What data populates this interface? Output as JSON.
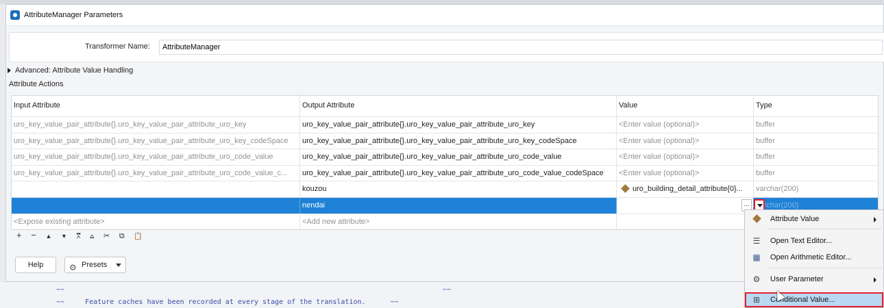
{
  "window": {
    "title": "AttributeManager Parameters"
  },
  "transformer": {
    "label": "Transformer Name:",
    "value": "AttributeManager"
  },
  "advanced": {
    "label": "Advanced: Attribute Value Handling"
  },
  "section": {
    "label": "Attribute Actions"
  },
  "table": {
    "headers": {
      "input": "Input Attribute",
      "output": "Output Attribute",
      "value": "Value",
      "type": "Type"
    },
    "rows": [
      {
        "input": "uro_key_value_pair_attribute{}.uro_key_value_pair_attribute_uro_key",
        "output": "uro_key_value_pair_attribute{}.uro_key_value_pair_attribute_uro_key",
        "value": "<Enter value (optional)>",
        "type": "buffer"
      },
      {
        "input": "uro_key_value_pair_attribute{}.uro_key_value_pair_attribute_uro_key_codeSpace",
        "output": "uro_key_value_pair_attribute{}.uro_key_value_pair_attribute_uro_key_codeSpace",
        "value": "<Enter value (optional)>",
        "type": "buffer"
      },
      {
        "input": "uro_key_value_pair_attribute{}.uro_key_value_pair_attribute_uro_code_value",
        "output": "uro_key_value_pair_attribute{}.uro_key_value_pair_attribute_uro_code_value",
        "value": "<Enter value (optional)>",
        "type": "buffer"
      },
      {
        "input": "uro_key_value_pair_attribute{}.uro_key_value_pair_attribute_uro_code_value_c...",
        "output": "uro_key_value_pair_attribute{}.uro_key_value_pair_attribute_uro_code_value_codeSpace",
        "value": "<Enter value (optional)>",
        "type": "buffer"
      },
      {
        "input": "",
        "output": "kouzou",
        "value": "uro_building_detail_attribute{0}...",
        "type": "varchar(200)"
      },
      {
        "input": "",
        "output": "nendai",
        "value": "",
        "type": "varchar(200)"
      },
      {
        "input": "<Expose existing attribute>",
        "output": "<Add new attribute>",
        "value": "",
        "type": ""
      }
    ]
  },
  "toolbar": {
    "add": "+",
    "remove": "−",
    "up": "▲",
    "down": "▼",
    "top": "⩞",
    "bottom": "⩟",
    "cut": "✂",
    "copy": "⧉",
    "paste": "📋"
  },
  "buttons": {
    "help": "Help",
    "presets": "Presets"
  },
  "ellipsis": "...",
  "menu": {
    "items": [
      {
        "label": "Attribute Value",
        "icon": "attribute-diamond-icon"
      },
      {
        "label": "Open Text Editor...",
        "icon": "text-editor-icon"
      },
      {
        "label": "Open Arithmetic Editor...",
        "icon": "calculator-icon"
      },
      {
        "label": "User Parameter",
        "icon": "gear-icon"
      },
      {
        "label": "Conditional Value...",
        "icon": "table-grid-icon"
      }
    ]
  },
  "background_log": {
    "line1_left": "~~",
    "line1_right": "~~",
    "line2": "~~     Feature caches have been recorded at every stage of the translation.      ~~"
  },
  "colors": {
    "selection": "#1f82d6",
    "highlight_border": "#e5202e",
    "menu_hover": "#b9d8f3"
  }
}
